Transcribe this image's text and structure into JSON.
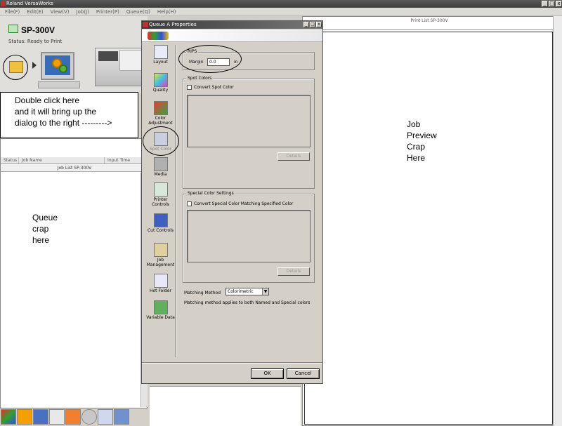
{
  "app": {
    "title": "Roland VersaWorks"
  },
  "window_controls": [
    "_",
    "□",
    "x"
  ],
  "menu": [
    "File(F)",
    "Edit(E)",
    "View(V)",
    "Job(J)",
    "Printer(P)",
    "Queue(Q)",
    "Help(H)"
  ],
  "printer": {
    "name": "SP-300V",
    "status": "Status: Ready to Print"
  },
  "callout_note": {
    "lines": [
      "Double click here",
      "and it will bring up the",
      "dialog to the right --------->"
    ]
  },
  "queue": {
    "columns": [
      "Status",
      "Job Name",
      "Input Time"
    ],
    "list_title": "Job List SP-300V",
    "note_lines": [
      "Queue",
      "crap",
      "here"
    ]
  },
  "preview": {
    "title": "Print List SP-300V",
    "note_lines": [
      "Job",
      "Preview",
      "Crap",
      "Here"
    ]
  },
  "dialog": {
    "title": "Queue A Properties",
    "nav": [
      {
        "label": "Layout",
        "icon": "layout-icon"
      },
      {
        "label": "Quality",
        "icon": "quality-icon"
      },
      {
        "label": "Color Adjustment",
        "icon": "color-adjustment-icon"
      },
      {
        "label": "Spot Color",
        "icon": "spot-color-icon"
      },
      {
        "label": "Media",
        "icon": "media-icon"
      },
      {
        "label": "Printer Controls",
        "icon": "printer-controls-icon"
      },
      {
        "label": "Cut Controls",
        "icon": "cut-controls-icon"
      },
      {
        "label": "Job Management",
        "icon": "job-management-icon"
      },
      {
        "label": "Hot Folder",
        "icon": "hot-folder-icon"
      },
      {
        "label": "Variable Data",
        "icon": "variable-data-icon"
      }
    ],
    "rips": {
      "group_label": "RIPS",
      "margin_label": "Margin",
      "margin_value": "0.0",
      "margin_unit": "in"
    },
    "spot_colors": {
      "group_label": "Spot Colors",
      "checkbox_label": "Convert Spot Color",
      "details_label": "Details"
    },
    "special_colors": {
      "group_label": "Special Color Settings",
      "checkbox_label": "Convert Special Color Matching Specified Color",
      "details_label": "Details"
    },
    "matching": {
      "label": "Matching Method",
      "value": "Colorimetric",
      "note": "Matching method applies to both Named and Special colors"
    },
    "ok_label": "OK",
    "cancel_label": "Cancel"
  },
  "colors": {
    "titlebar": "#3c3c3c",
    "dialog_bg": "#d4d0c8",
    "folder": "#f0c040"
  }
}
